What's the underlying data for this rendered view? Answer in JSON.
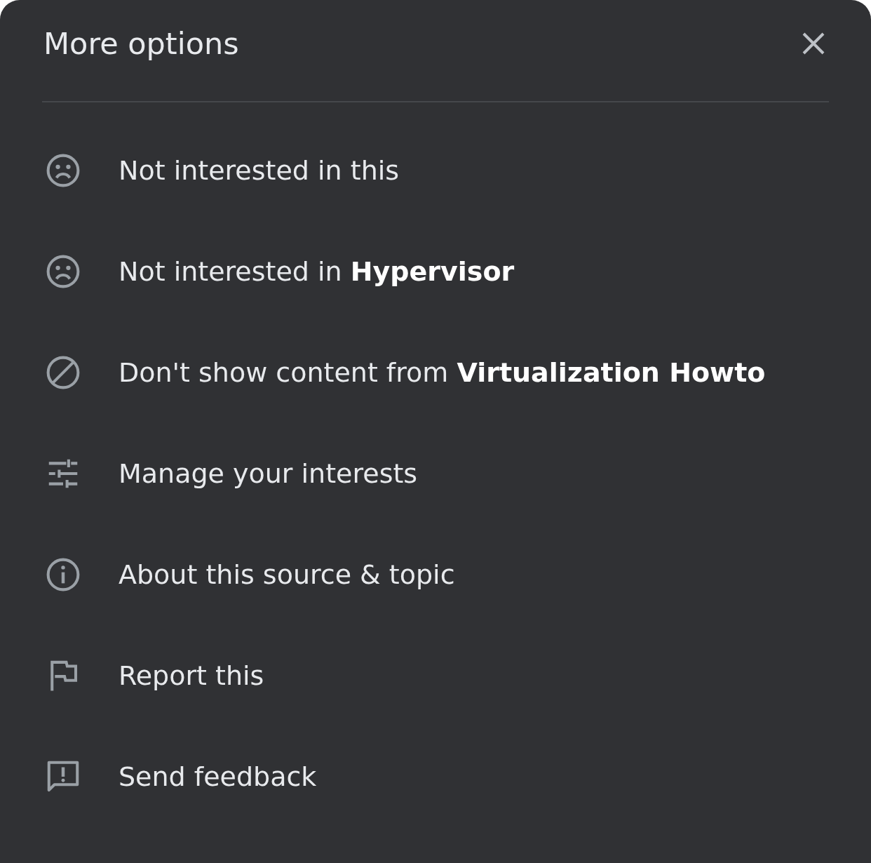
{
  "dialog": {
    "title": "More options"
  },
  "options": [
    {
      "kind": "sad",
      "label": "Not interested in this"
    },
    {
      "kind": "sad",
      "label": "Not interested in **Hypervisor**"
    },
    {
      "kind": "block",
      "label": "Don't show content from **Virtualization Howto**"
    },
    {
      "kind": "tune",
      "label": "Manage your interests"
    },
    {
      "kind": "info",
      "label": "About this source & topic"
    },
    {
      "kind": "flag",
      "label": "Report this"
    },
    {
      "kind": "feedback",
      "label": "Send feedback"
    }
  ]
}
